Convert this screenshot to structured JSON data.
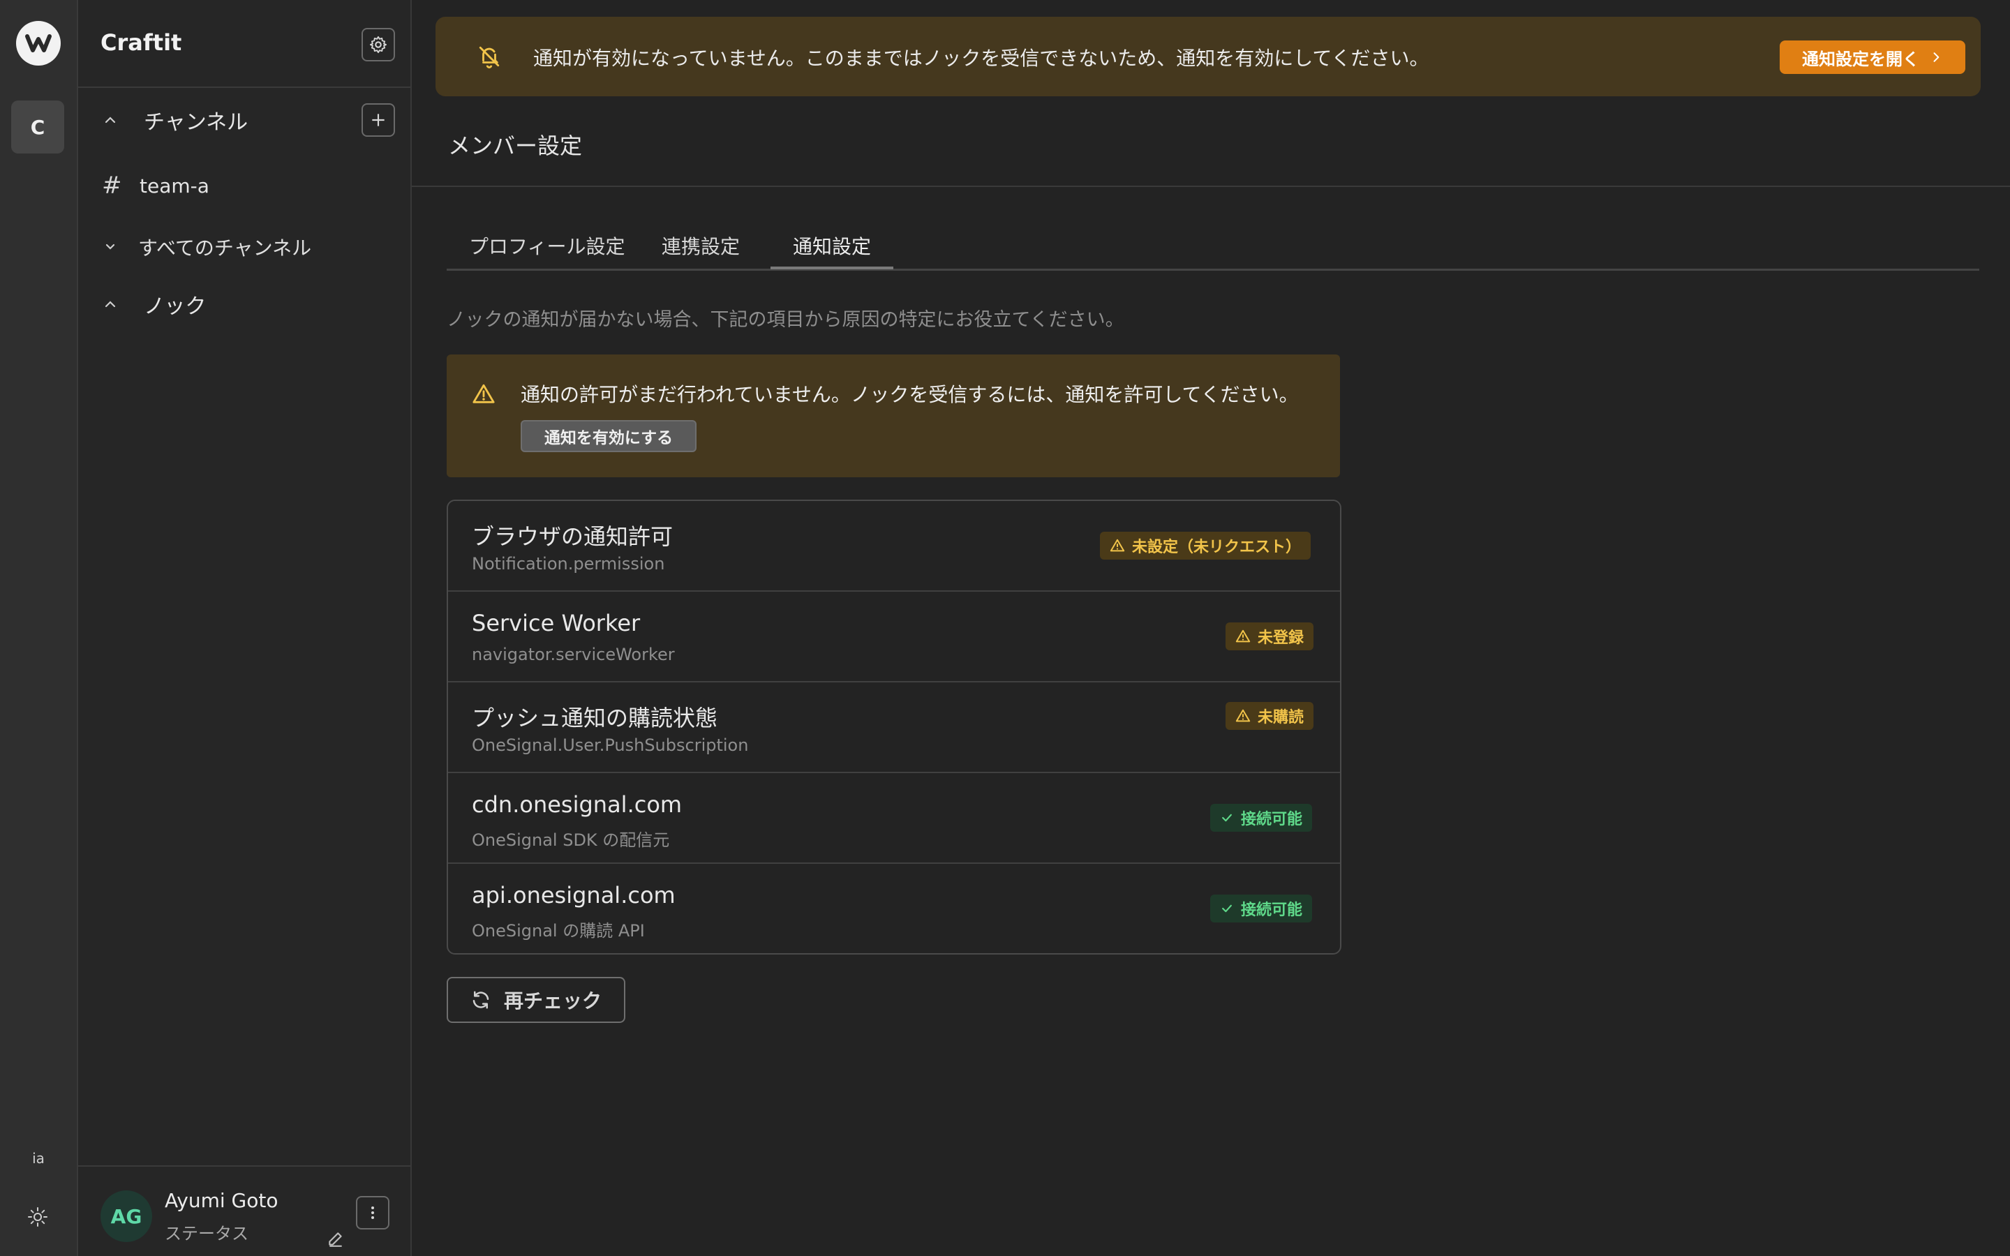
{
  "app": {
    "workspace_title": "Craftit",
    "workspace_initial": "C",
    "rail_label": "ia"
  },
  "sidebar": {
    "channels_label": "チャンネル",
    "channels": [
      {
        "name": "team-a"
      }
    ],
    "all_channels_label": "すべてのチャンネル",
    "knock_label": "ノック"
  },
  "user": {
    "initials": "AG",
    "name": "Ayumi Goto",
    "status": "ステータス"
  },
  "banner": {
    "text": "通知が有効になっていません。このままではノックを受信できないため、通知を有効にしてください。",
    "button_label": "通知設定を開く"
  },
  "page": {
    "title": "メンバー設定"
  },
  "tabs": [
    {
      "label": "プロフィール設定",
      "active": false
    },
    {
      "label": "連携設定",
      "active": false
    },
    {
      "label": "通知設定",
      "active": true
    }
  ],
  "notifications": {
    "hint": "ノックの通知が届かない場合、下記の項目から原因の特定にお役立てください。",
    "warning_text": "通知の許可がまだ行われていません。ノックを受信するには、通知を許可してください。",
    "enable_button": "通知を有効にする",
    "checks": [
      {
        "title": "ブラウザの通知許可",
        "subtitle": "Notification.permission",
        "status": "未設定（未リクエスト）",
        "level": "warn"
      },
      {
        "title": "Service Worker",
        "subtitle": "navigator.serviceWorker",
        "status": "未登録",
        "level": "warn"
      },
      {
        "title": "プッシュ通知の購読状態",
        "subtitle": "OneSignal.User.PushSubscription",
        "status": "未購読",
        "level": "warn"
      },
      {
        "title": "cdn.onesignal.com",
        "subtitle": "OneSignal SDK の配信元",
        "status": "接続可能",
        "level": "ok"
      },
      {
        "title": "api.onesignal.com",
        "subtitle": "OneSignal の購読 API",
        "status": "接続可能",
        "level": "ok"
      }
    ],
    "recheck_label": "再チェック"
  },
  "colors": {
    "accent_orange": "#e07f13",
    "warn_bg": "#45381e",
    "ok_green": "#5fd98a",
    "warn_yellow": "#f2c44a"
  }
}
